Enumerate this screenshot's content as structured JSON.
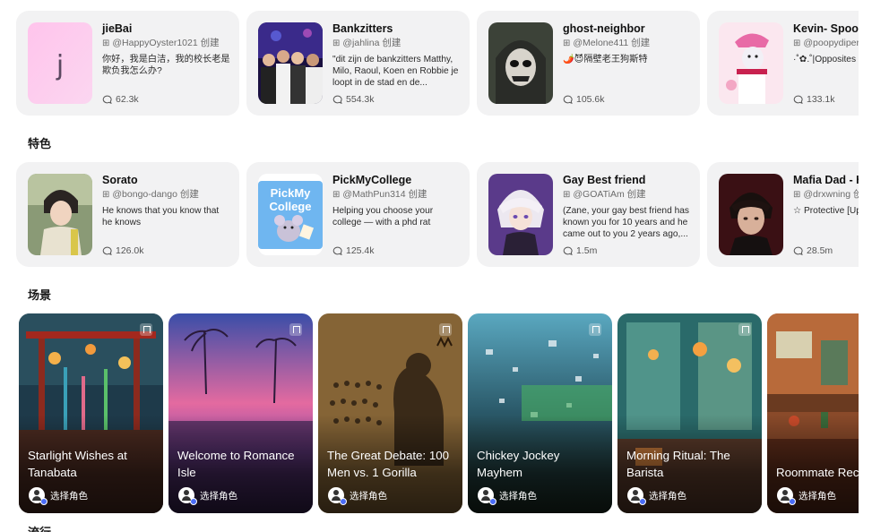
{
  "sections": {
    "featured": "特色",
    "scenes": "场景",
    "popular": "流行"
  },
  "row1": [
    {
      "name": "jieBai",
      "creator": "@HappyOyster1021 创建",
      "desc": "你好，我是白洁，我的校长老是欺负我怎么办?",
      "count": "62.3k",
      "avatar_letter": "j"
    },
    {
      "name": "Bankzitters",
      "creator": "@jahlina 创建",
      "desc": "\"dit zijn de bankzitters Matthy, Milo, Raoul, Koen en Robbie je loopt in de stad en de...",
      "count": "554.3k"
    },
    {
      "name": "ghost-neighbor",
      "creator": "@Melone411 创建",
      "desc": "🌶️😈隔壁老王狗斯特",
      "count": "105.6k"
    },
    {
      "name": "Kevin- Spooky",
      "creator": "@poopydiper",
      "desc": "·˚✿.˚|Opposites",
      "count": "133.1k"
    }
  ],
  "row2": [
    {
      "name": "Sorato",
      "creator": "@bongo-dango 创建",
      "desc": "He knows that you know that he knows",
      "count": "126.0k"
    },
    {
      "name": "PickMyCollege",
      "creator": "@MathPun314 创建",
      "desc": "Helping you choose your college — with a phd rat",
      "count": "125.4k",
      "logo_line1": "PickMy",
      "logo_line2": "College"
    },
    {
      "name": "Gay Best friend",
      "creator": "@GOATiAm 创建",
      "desc": "(Zane, your gay best friend has known you for 10 years and he came out to you 2 years ago,...",
      "count": "1.5m"
    },
    {
      "name": "Mafia Dad - H",
      "creator": "@drxwning 创",
      "desc": "☆ Protective [Up",
      "count": "28.5m"
    }
  ],
  "scenes": [
    {
      "title": "Starlight Wishes at Tanabata",
      "role": "选择角色"
    },
    {
      "title": "Welcome to Romance Isle",
      "role": "选择角色"
    },
    {
      "title": "The Great Debate: 100 Men vs. 1 Gorilla",
      "role": "选择角色"
    },
    {
      "title": "Chickey Jockey Mayhem",
      "role": "选择角色"
    },
    {
      "title": "Morning Ritual: The Barista",
      "role": "选择角色"
    },
    {
      "title": "Roommate Rec Rescue",
      "role": "选择角色"
    }
  ],
  "icons": {
    "chat": "chat-bubble-icon",
    "creator": "creator-icon",
    "bookmark": "bookmark-icon",
    "role": "user-avatar-icon"
  }
}
